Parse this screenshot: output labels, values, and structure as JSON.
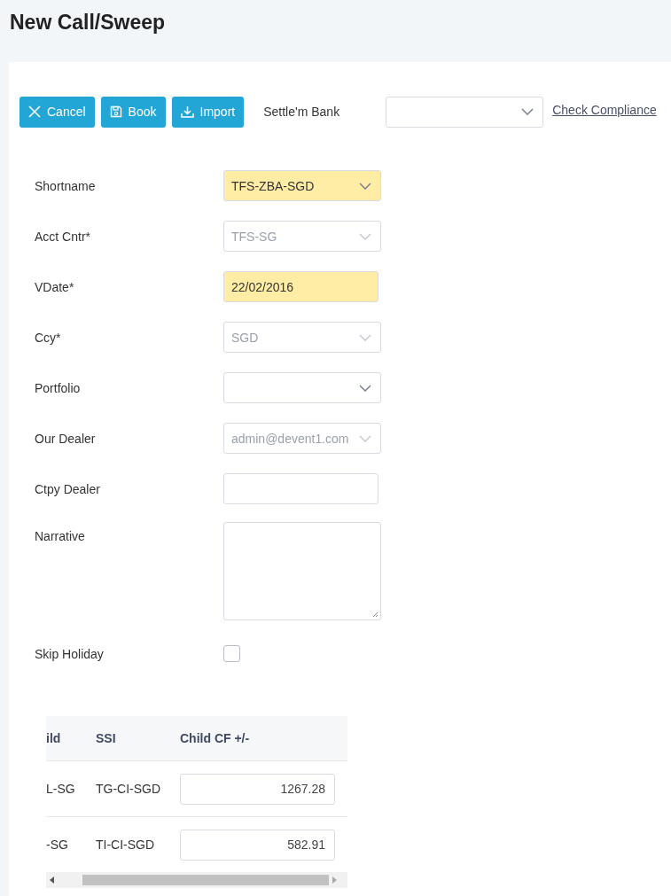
{
  "page": {
    "title": "New Call/Sweep"
  },
  "toolbar": {
    "buttons": [
      {
        "kind": "cancel",
        "label": "Cancel"
      },
      {
        "kind": "book",
        "label": "Book"
      },
      {
        "kind": "import",
        "label": "Import"
      }
    ],
    "settle_bank": {
      "label": "Settle'm Bank"
    },
    "link": "Check Compliance"
  },
  "form": [
    {
      "kind": "select",
      "label": "Shortname",
      "value": "TFS-ZBA-SGD",
      "highlighted": true,
      "disabled": false
    },
    {
      "kind": "select",
      "label": "Acct Cntr*",
      "value": "TFS-SG",
      "highlighted": false,
      "disabled": true
    },
    {
      "kind": "text",
      "label": "VDate*",
      "value": "22/02/2016",
      "highlighted": true,
      "disabled": false
    },
    {
      "kind": "select",
      "label": "Ccy*",
      "value": "SGD",
      "highlighted": false,
      "disabled": true
    },
    {
      "kind": "select",
      "label": "Portfolio",
      "highlighted": false,
      "disabled": false
    },
    {
      "kind": "select",
      "label": "Our Dealer",
      "value": "admin@devent1.com",
      "highlighted": false,
      "disabled": true
    },
    {
      "kind": "text",
      "label": "Ctpy Dealer",
      "highlighted": false
    },
    {
      "kind": "textarea",
      "label": "Narrative",
      "highlighted": false
    },
    {
      "kind": "checkbox",
      "label": "Skip Holiday",
      "checked": false
    }
  ],
  "table": {
    "columns": [
      "ild",
      "SSI",
      "Child CF +/-"
    ],
    "rows": [
      [
        "L-SG",
        "TG-CI-SGD",
        "1267.28"
      ],
      [
        "-SG",
        "TI-CI-SGD",
        "582.91"
      ]
    ]
  }
}
